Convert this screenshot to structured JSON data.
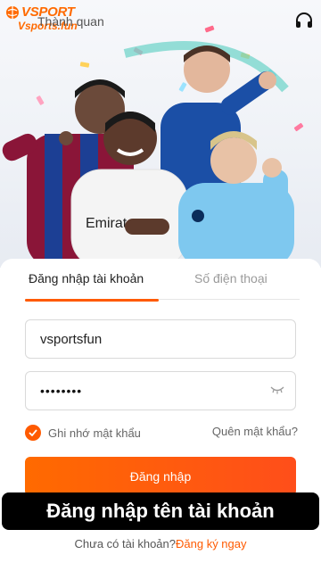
{
  "brand": {
    "name": "VSPORT",
    "url": "Vsports.fun"
  },
  "header": {
    "back_label": "Thành quan"
  },
  "icons": {
    "logo": "ball-logo-icon",
    "support": "headset-icon",
    "password_toggle": "eye-hidden-icon",
    "remember": "check-icon"
  },
  "colors": {
    "accent": "#ff5a00",
    "button_gradient_start": "#ff6a00",
    "button_gradient_end": "#ff4e1a",
    "caption_bg": "#000000"
  },
  "tabs": [
    {
      "label": "Đăng nhập tài khoản",
      "active": true
    },
    {
      "label": "Số điện thoại",
      "active": false
    }
  ],
  "form": {
    "username_value": "vsportsfun",
    "password_masked": "••••••••",
    "remember_label": "Ghi nhớ mật khẩu",
    "remember_checked": true,
    "forgot_label": "Quên mật khẩu?",
    "submit_label": "Đăng nhập"
  },
  "caption": "Đăng nhập tên tài khoản",
  "signup": {
    "prompt": "Chưa có tài khoản?",
    "link": "Đăng ký ngay"
  }
}
